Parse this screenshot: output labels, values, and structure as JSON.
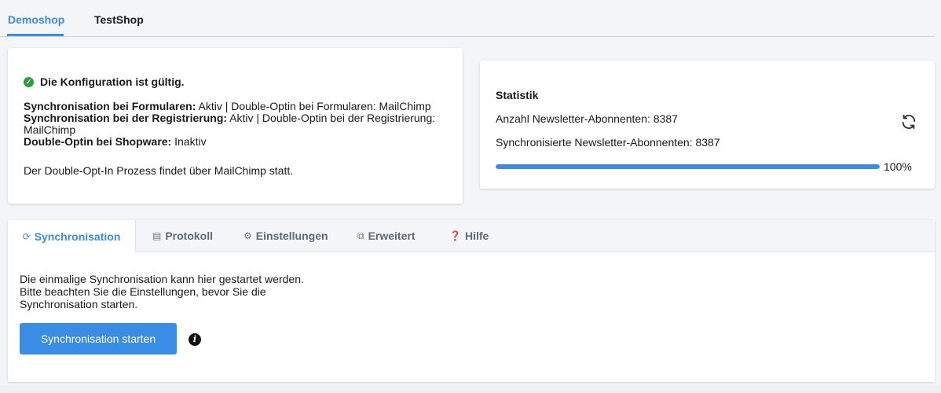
{
  "shop_tabs": [
    {
      "label": "Demoshop",
      "active": true
    },
    {
      "label": "TestShop",
      "active": false
    }
  ],
  "config": {
    "status": "Die Konfiguration ist gültig.",
    "lines": [
      {
        "key": "Synchronisation bei Formularen:",
        "value": " Aktiv | Double-Optin bei Formularen: MailChimp"
      },
      {
        "key": "Synchronisation bei der Registrierung:",
        "value": " Aktiv | Double-Optin bei der Registrierung: MailChimp"
      },
      {
        "key": "Double-Optin bei Shopware:",
        "value": " Inaktiv"
      }
    ],
    "footer": "Der Double-Opt-In Prozess findet über MailChimp statt."
  },
  "stats": {
    "title": "Statistik",
    "subscribers": "Anzahl Newsletter-Abonnenten: 8387",
    "synced": "Synchronisierte Newsletter-Abonnenten: 8387",
    "progress_percent": 100,
    "progress_label": "100%"
  },
  "panel": {
    "tabs": [
      {
        "label": "Synchronisation",
        "icon": "sync-icon",
        "active": true
      },
      {
        "label": "Protokoll",
        "icon": "document-icon",
        "active": false
      },
      {
        "label": "Einstellungen",
        "icon": "gear-icon",
        "active": false
      },
      {
        "label": "Erweitert",
        "icon": "external-icon",
        "active": false
      },
      {
        "label": "Hilfe",
        "icon": "help-icon",
        "active": false
      }
    ],
    "body_lines": [
      "Die einmalige Synchronisation kann hier gestartet werden.",
      "Bitte beachten Sie die Einstellungen, bevor Sie die",
      "Synchronisation starten."
    ],
    "button_label": "Synchronisation starten"
  },
  "colors": {
    "accent": "#3a8ce6",
    "success": "#2c9c3c"
  }
}
